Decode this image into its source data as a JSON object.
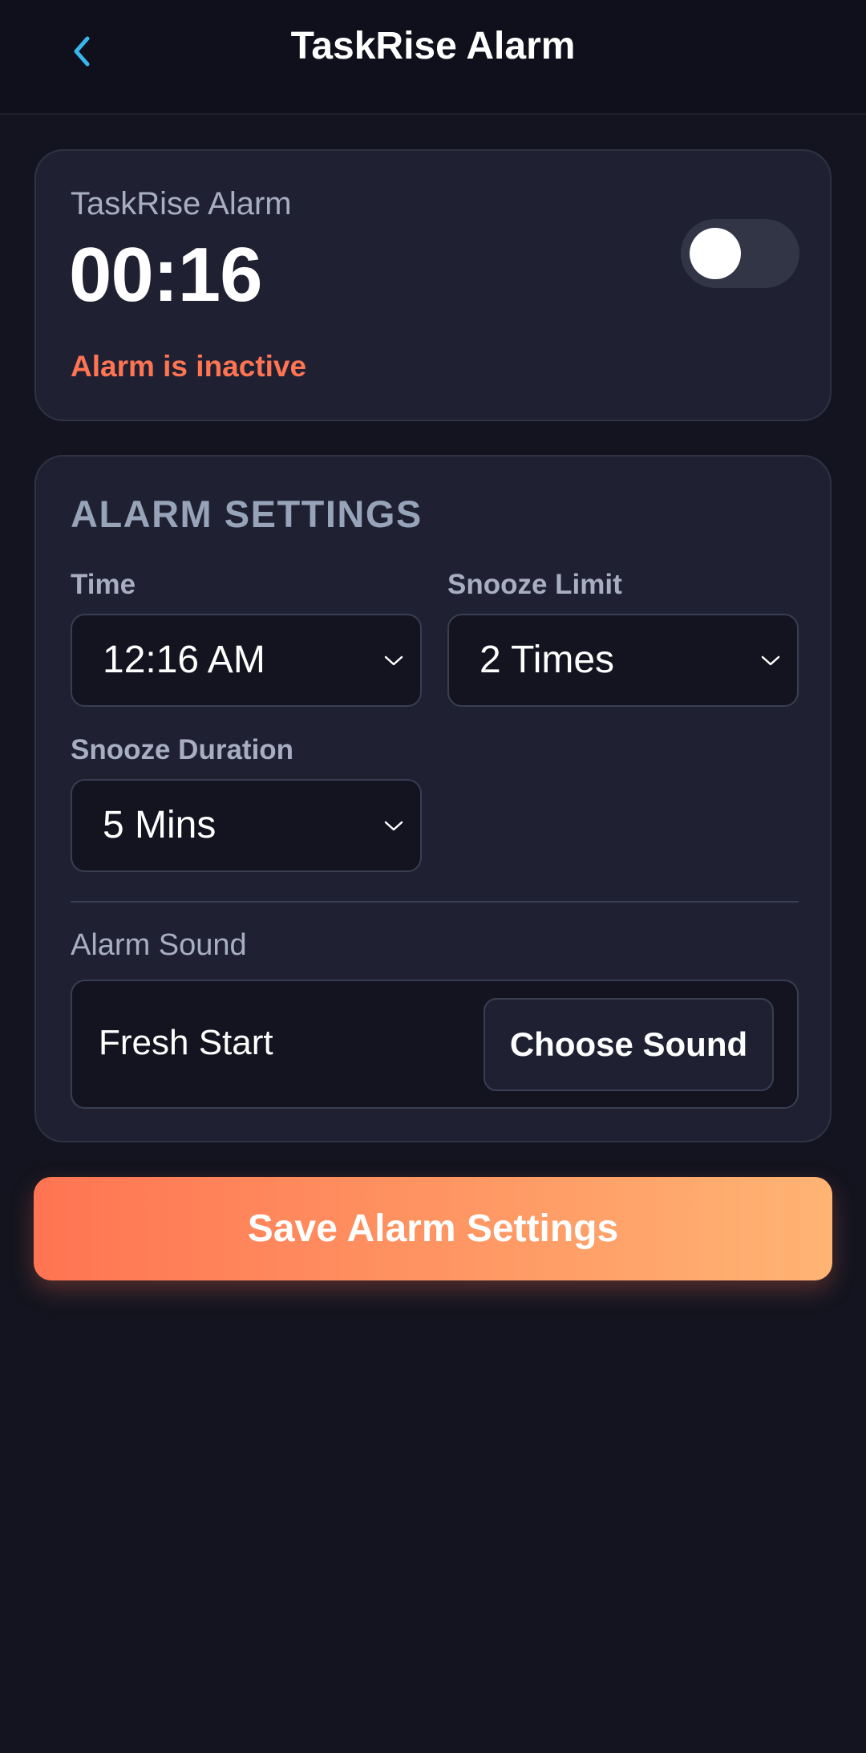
{
  "header": {
    "title": "TaskRise Alarm",
    "back_icon": "chevron-left-icon",
    "back_icon_color": "#39b5ee"
  },
  "status_card": {
    "label": "TaskRise Alarm",
    "time": "00:16",
    "status_text": "Alarm is inactive",
    "status_color": "#ff7452",
    "toggle_on": false
  },
  "settings": {
    "title": "ALARM SETTINGS",
    "time": {
      "label": "Time",
      "value": "12:16 AM"
    },
    "snooze_limit": {
      "label": "Snooze Limit",
      "value": "2 Times"
    },
    "snooze_duration": {
      "label": "Snooze Duration",
      "value": "5 Mins"
    },
    "sound": {
      "label": "Alarm Sound",
      "value": "Fresh Start",
      "button_label": "Choose Sound"
    }
  },
  "save_button": {
    "label": "Save Alarm Settings",
    "gradient": [
      "#ff7452",
      "#ffb474"
    ]
  }
}
